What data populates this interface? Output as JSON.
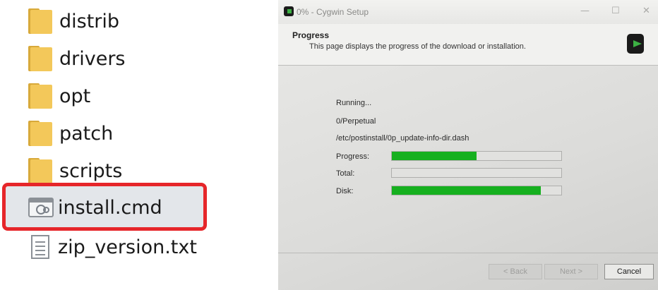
{
  "explorer": {
    "items": [
      {
        "name": "distrib",
        "icon": "folder-icon"
      },
      {
        "name": "drivers",
        "icon": "folder-icon"
      },
      {
        "name": "opt",
        "icon": "folder-icon"
      },
      {
        "name": "patch",
        "icon": "folder-icon"
      },
      {
        "name": "scripts",
        "icon": "folder-icon"
      },
      {
        "name": "install.cmd",
        "icon": "cmd-file-icon",
        "highlighted": true
      },
      {
        "name": "zip_version.txt",
        "icon": "text-file-icon"
      }
    ],
    "highlight_color": "#e6262a"
  },
  "setup": {
    "window_title": "0% - Cygwin Setup",
    "header_title": "Progress",
    "header_subtitle": "This page displays the progress of the download or installation.",
    "status_lines": [
      "Running...",
      "0/Perpetual",
      "/etc/postinstall/0p_update-info-dir.dash"
    ],
    "progress_label": "Progress:",
    "total_label": "Total:",
    "disk_label": "Disk:",
    "progress_fraction": 0.5,
    "total_fraction": 0,
    "disk_fraction": 0.88,
    "bar_color": "#16b01f",
    "back_label": "< Back",
    "next_label": "Next >",
    "cancel_label": "Cancel"
  }
}
